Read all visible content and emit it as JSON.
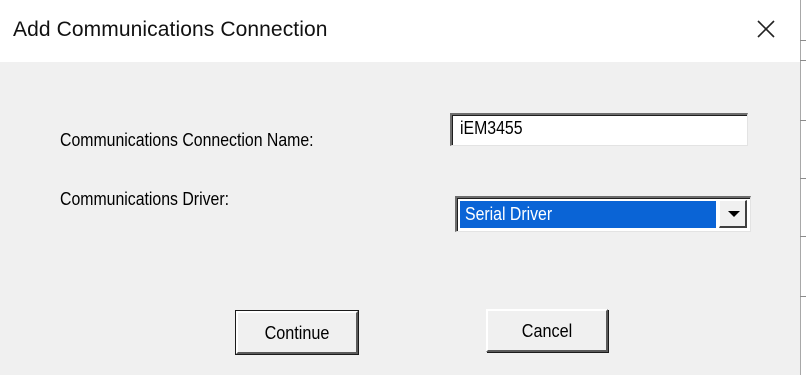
{
  "window": {
    "title": "Add Communications Connection",
    "close_icon": "close-icon"
  },
  "form": {
    "connection_name_label": "Communications Connection Name:",
    "connection_name_value": "iEM3455",
    "driver_label": "Communications Driver:",
    "driver_selected": "Serial Driver",
    "dropdown_icon": "chevron-down-icon"
  },
  "buttons": {
    "continue_label": "Continue",
    "cancel_label": "Cancel"
  },
  "colors": {
    "selection_highlight": "#0a64d6",
    "dialog_background": "#f0f0f0",
    "titlebar_background": "#ffffff"
  }
}
